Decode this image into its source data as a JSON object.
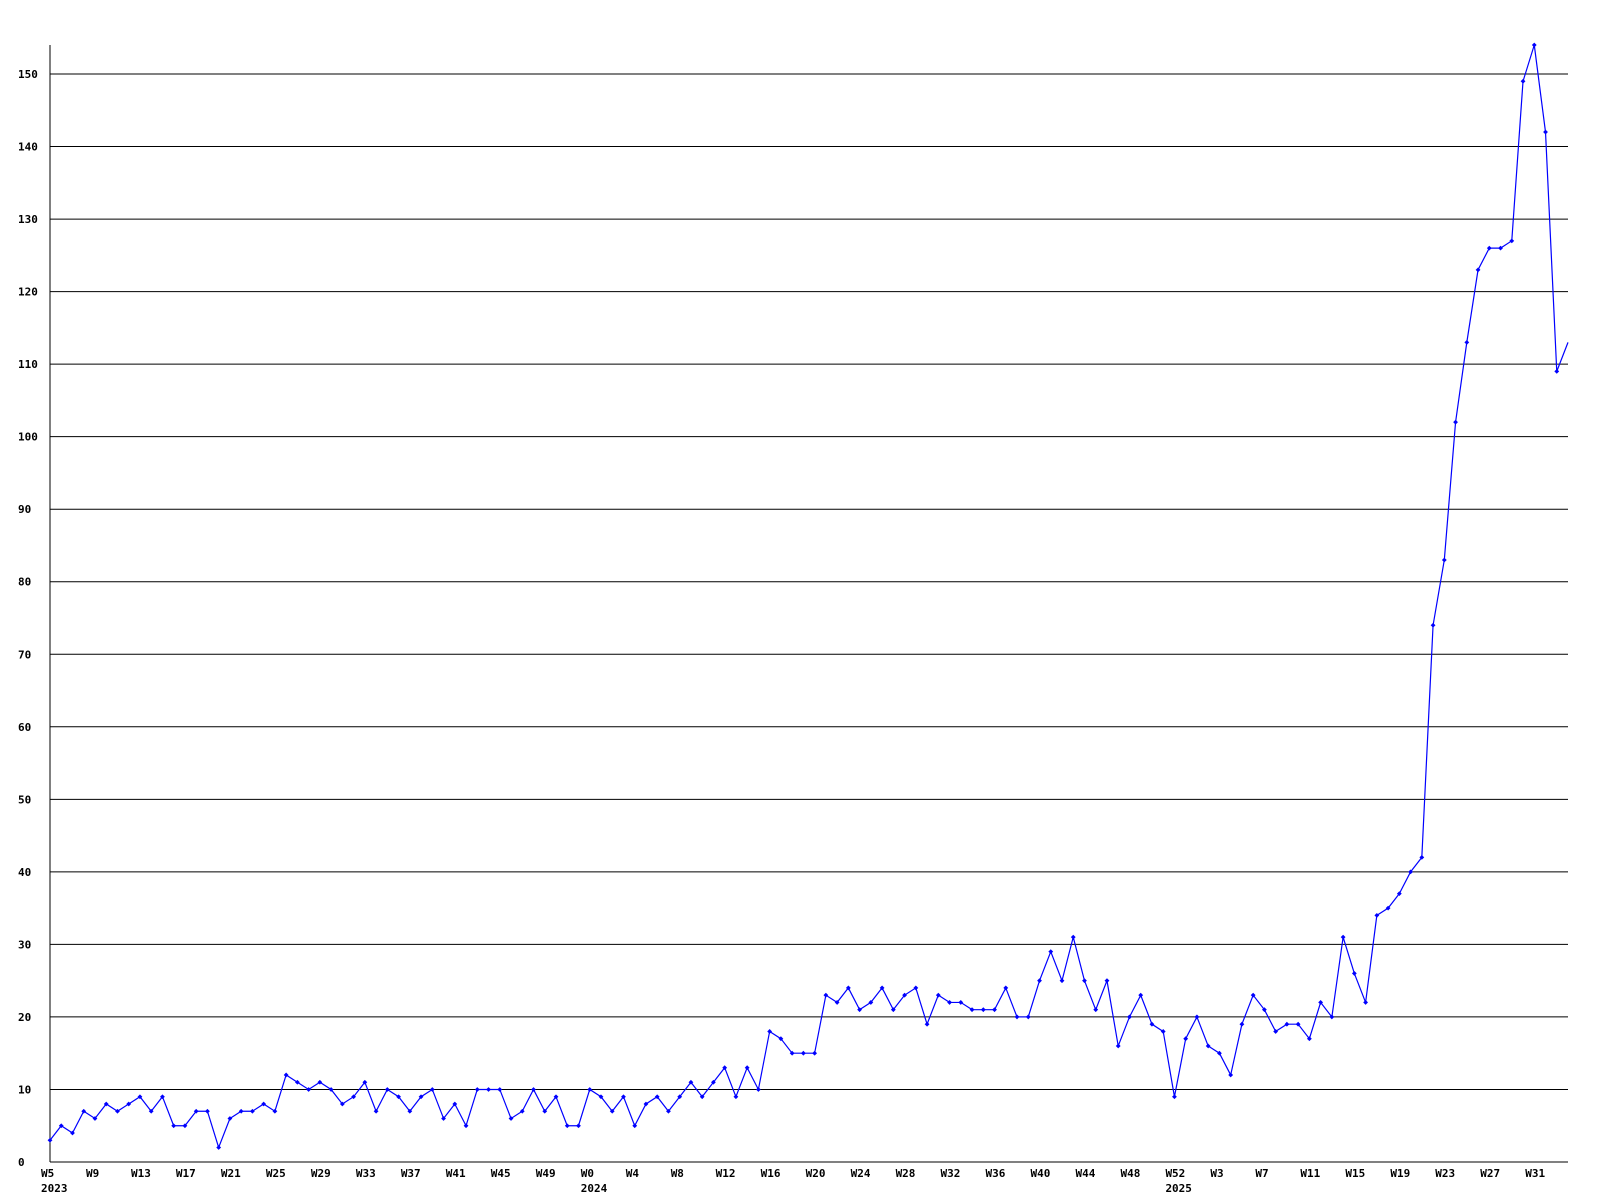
{
  "colors": {
    "series": "#0000ff",
    "grid": "#000000",
    "axis": "#000000",
    "background": "#ffffff"
  },
  "chart_data": {
    "type": "line",
    "title": "",
    "xlabel": "",
    "ylabel": "",
    "ylim": [
      0,
      154
    ],
    "grid": "horizontal",
    "y_ticks": [
      0,
      10,
      20,
      30,
      40,
      50,
      60,
      70,
      80,
      90,
      100,
      110,
      120,
      130,
      140,
      150
    ],
    "x_tick_labels": [
      {
        "week_index": 0,
        "label": "W5",
        "year": "2023"
      },
      {
        "week_index": 4,
        "label": "W9"
      },
      {
        "week_index": 8,
        "label": "W13"
      },
      {
        "week_index": 12,
        "label": "W17"
      },
      {
        "week_index": 16,
        "label": "W21"
      },
      {
        "week_index": 20,
        "label": "W25"
      },
      {
        "week_index": 24,
        "label": "W29"
      },
      {
        "week_index": 28,
        "label": "W33"
      },
      {
        "week_index": 32,
        "label": "W37"
      },
      {
        "week_index": 36,
        "label": "W41"
      },
      {
        "week_index": 40,
        "label": "W45"
      },
      {
        "week_index": 44,
        "label": "W49"
      },
      {
        "week_index": 48,
        "label": "W0",
        "year": "2024"
      },
      {
        "week_index": 52,
        "label": "W4"
      },
      {
        "week_index": 56,
        "label": "W8"
      },
      {
        "week_index": 60,
        "label": "W12"
      },
      {
        "week_index": 64,
        "label": "W16"
      },
      {
        "week_index": 68,
        "label": "W20"
      },
      {
        "week_index": 72,
        "label": "W24"
      },
      {
        "week_index": 76,
        "label": "W28"
      },
      {
        "week_index": 80,
        "label": "W32"
      },
      {
        "week_index": 84,
        "label": "W36"
      },
      {
        "week_index": 88,
        "label": "W40"
      },
      {
        "week_index": 92,
        "label": "W44"
      },
      {
        "week_index": 96,
        "label": "W48"
      },
      {
        "week_index": 100,
        "label": "W52",
        "year": "2025"
      },
      {
        "week_index": 104,
        "label": "W3"
      },
      {
        "week_index": 108,
        "label": "W7"
      },
      {
        "week_index": 112,
        "label": "W11"
      },
      {
        "week_index": 116,
        "label": "W15"
      },
      {
        "week_index": 120,
        "label": "W19"
      },
      {
        "week_index": 124,
        "label": "W23"
      },
      {
        "week_index": 128,
        "label": "W27"
      },
      {
        "week_index": 132,
        "label": "W31"
      }
    ],
    "series": [
      {
        "values": [
          3,
          5,
          4,
          7,
          6,
          8,
          7,
          8,
          9,
          7,
          9,
          5,
          5,
          7,
          7,
          2,
          6,
          7,
          7,
          8,
          7,
          12,
          11,
          10,
          11,
          10,
          8,
          9,
          11,
          7,
          10,
          9,
          7,
          9,
          10,
          6,
          8,
          5,
          10,
          10,
          10,
          6,
          7,
          10,
          7,
          9,
          5,
          5,
          10,
          9,
          7,
          9,
          5,
          8,
          9,
          7,
          9,
          11,
          9,
          11,
          13,
          9,
          13,
          10,
          18,
          17,
          15,
          15,
          15,
          23,
          22,
          24,
          21,
          22,
          24,
          21,
          23,
          24,
          19,
          23,
          22,
          22,
          21,
          21,
          21,
          24,
          20,
          20,
          25,
          29,
          25,
          31,
          25,
          21,
          25,
          16,
          20,
          23,
          19,
          18,
          9,
          17,
          20,
          16,
          15,
          12,
          19,
          23,
          21,
          18,
          19,
          19,
          17,
          22,
          20,
          31,
          26,
          22,
          34,
          35,
          37,
          40,
          42,
          74,
          83,
          102,
          113,
          123,
          126,
          126,
          127,
          149,
          154,
          142,
          109,
          113
        ],
        "markers_through_index": 134
      }
    ]
  }
}
